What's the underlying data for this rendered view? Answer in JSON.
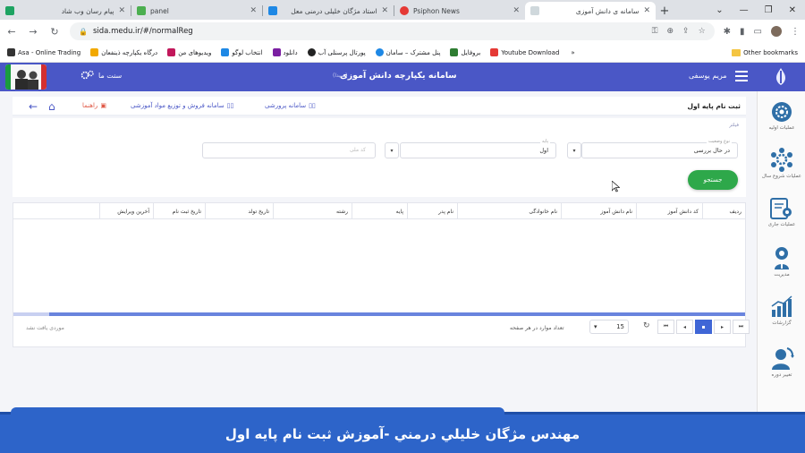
{
  "browser": {
    "tabs": [
      {
        "title": "پیام رسان وب شاد",
        "color": "#1ea362"
      },
      {
        "title": "panel",
        "color": "#4caf50"
      },
      {
        "title": "استاد مژگان خلیلی درمنی معل",
        "color": "#1e88e5"
      },
      {
        "title": "Psiphon News",
        "color": "#e53935"
      },
      {
        "title": "سامانه ی دانش آموزی",
        "color": "#90a4ae"
      }
    ],
    "url": "sida.medu.ir/#/normalReg",
    "bookmarks": [
      {
        "label": "Asa - Online Trading",
        "color": "#333"
      },
      {
        "label": "درگاه یکپارچه ذینفعان",
        "color": "#f2a900"
      },
      {
        "label": "ویدیوهای من",
        "color": "#c2185b"
      },
      {
        "label": "انتخاب لوگو",
        "color": "#1e88e5"
      },
      {
        "label": "دانلود",
        "color": "#7b1fa2"
      },
      {
        "label": "پورتال پرسنلی آب",
        "color": "#222"
      },
      {
        "label": "پنل مشترک – سامان",
        "color": "#1e88e5"
      },
      {
        "label": "بروفایل",
        "color": "#2e7d32"
      },
      {
        "label": "Youtube Download",
        "color": "#e53935"
      }
    ],
    "other_bookmarks": "Other bookmarks"
  },
  "header": {
    "title": "سامانه یکپارچه دانش آموزی",
    "title_sub": "(سیدا)",
    "season": "سنت ما",
    "user": "مریم یوسفی"
  },
  "toolbar": {
    "page_title": "ثبت نام پایه اول",
    "link_research": "سامانه پرورشی",
    "link_sales": "سامانه فروش و توزیع مواد آموزشی",
    "link_guide": "راهنما"
  },
  "filter": {
    "section_label": "فیلتر",
    "status_caption": "نوع وضعیت",
    "status_value": "در حال بررسی",
    "grade_caption": "پایه",
    "grade_value": "اول",
    "id_placeholder": "کد ملی",
    "search_button": "جستجو"
  },
  "grid": {
    "columns": [
      "ردیف",
      "کد دانش آموز",
      "نام دانش آموز",
      "نام خانوادگی",
      "نام پدر",
      "پایه",
      "رشته",
      "تاریخ تولد",
      "تاریخ ثبت نام",
      "آخرین ویرایش"
    ],
    "empty_message": "موردی یافت نشد",
    "per_page_label": "تعداد موارد در هر صفحه",
    "per_page_value": "15"
  },
  "sidebar": [
    {
      "label": "عملیات اولیه",
      "color": "#2f6fa7"
    },
    {
      "label": "عملیات شروع سال",
      "color": "#2f6fa7"
    },
    {
      "label": "عملیات جاری",
      "color": "#2f6fa7"
    },
    {
      "label": "مدیریت",
      "color": "#2f6fa7"
    },
    {
      "label": "گزارشات",
      "color": "#2f6fa7"
    },
    {
      "label": "تغییر دوره",
      "color": "#2f6fa7"
    }
  ],
  "caption": "مهندس مژگان خليلي درمني -آموزش ثبت نام پايه اول"
}
